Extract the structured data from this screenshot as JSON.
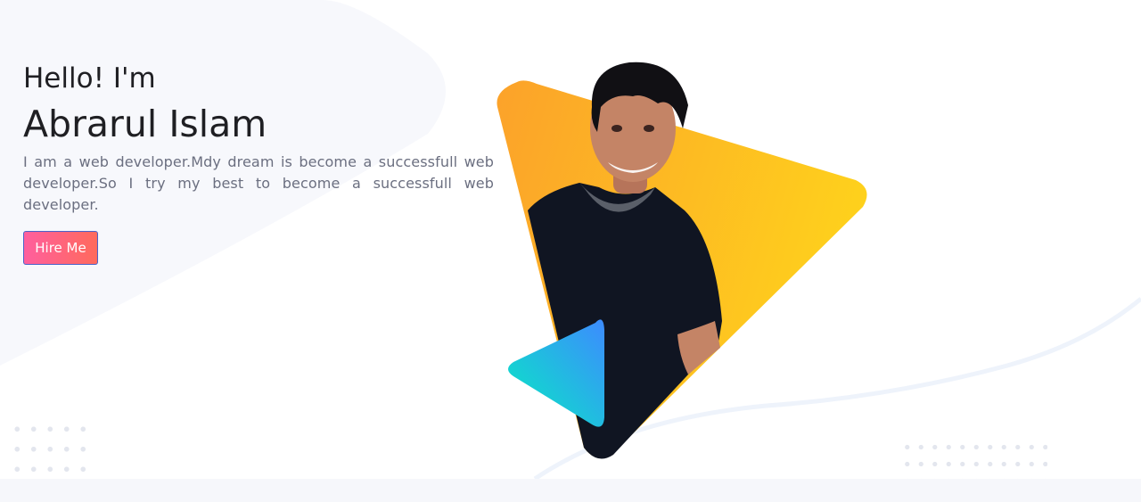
{
  "hero": {
    "greeting": "Hello! I'm",
    "name": "Abrarul Islam",
    "bio": "I am a web developer.Mdy dream is become a successfull web developer.So I try my best to become a successfull web developer.",
    "cta_label": "Hire Me"
  },
  "colors": {
    "cta_gradient_start": "#ff5f9e",
    "cta_gradient_end": "#ff6a5c",
    "triangle_orange": "#fca22a",
    "triangle_yellow": "#fed11c",
    "accent_triangle_start": "#3d8bff",
    "accent_triangle_end": "#06ecc2"
  }
}
